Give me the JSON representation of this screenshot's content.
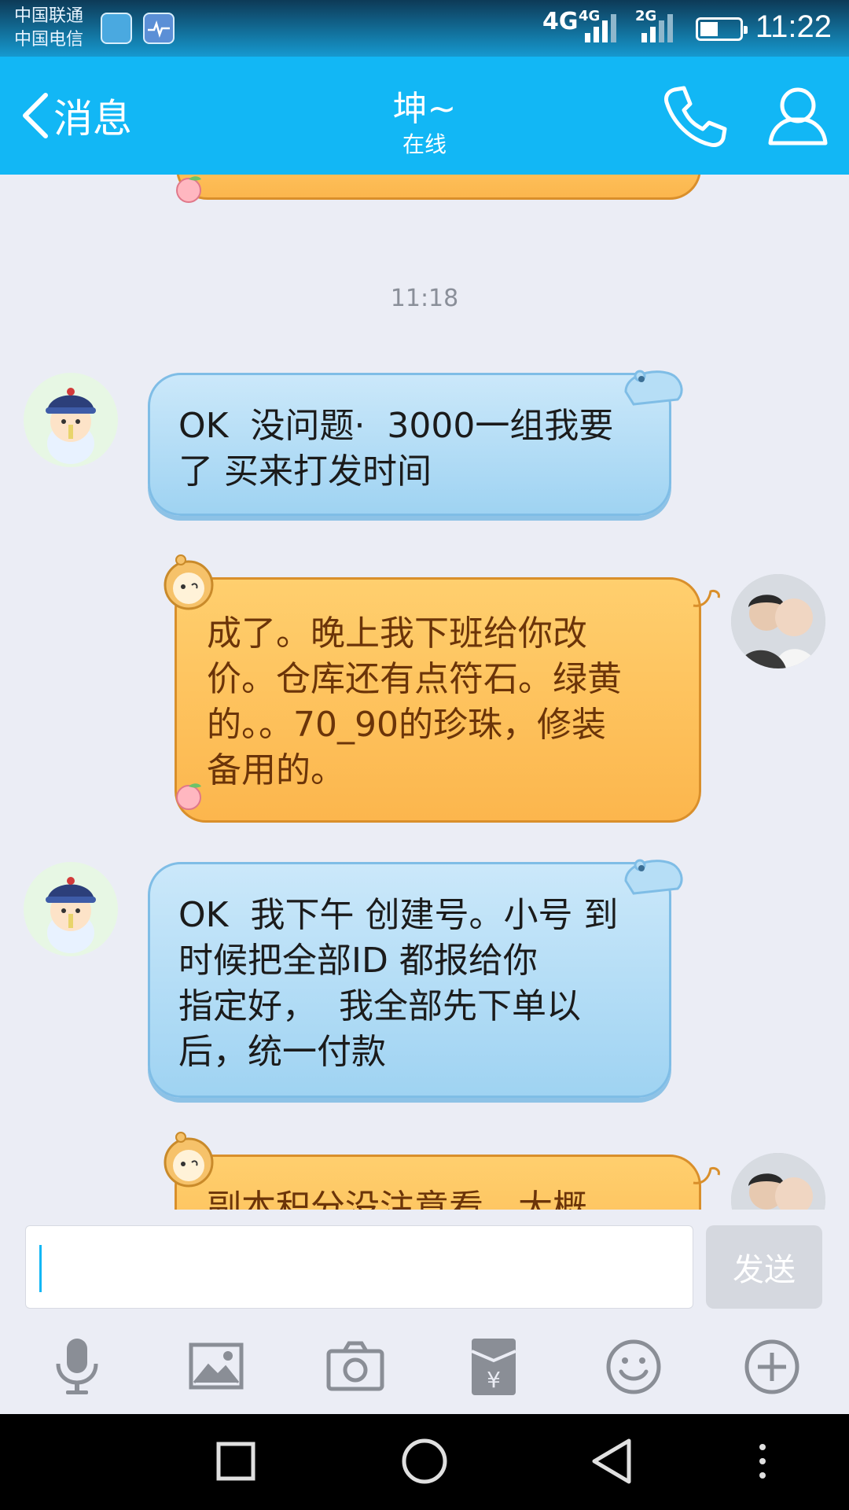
{
  "status_bar": {
    "carrier_1": "中国联通",
    "carrier_2": "中国电信",
    "network_1": "4G",
    "network_2": "4G",
    "network_3": "2G",
    "time": "11:22"
  },
  "header": {
    "back_label": "消息",
    "contact_name": "坤~",
    "contact_status": "在线"
  },
  "chat": {
    "timestamp": "11:18",
    "messages": [
      {
        "sender": "peer",
        "text": "OK  没问题·  3000一组我要\n了 买来打发时间"
      },
      {
        "sender": "me",
        "text": "成了。晚上我下班给你改\n价。仓库还有点符石。绿黄\n的。。70_90的珍珠，修装\n备用的。"
      },
      {
        "sender": "peer",
        "text": "OK  我下午 创建号。小号 到\n时候把全部ID 都报给你\n指定好，  我全部先下单以\n后，统一付款"
      },
      {
        "sender": "me",
        "text": "副本积分没注意看。大概"
      }
    ]
  },
  "input": {
    "value": "",
    "send_label": "发送"
  },
  "toolbar": {
    "icons": [
      "microphone-icon",
      "image-icon",
      "camera-icon",
      "red-packet-icon",
      "emoji-icon",
      "plus-icon"
    ]
  },
  "colors": {
    "accent": "#12b7f5",
    "peer_bubble": "#a9d8f5",
    "my_bubble": "#fdbd5a"
  }
}
